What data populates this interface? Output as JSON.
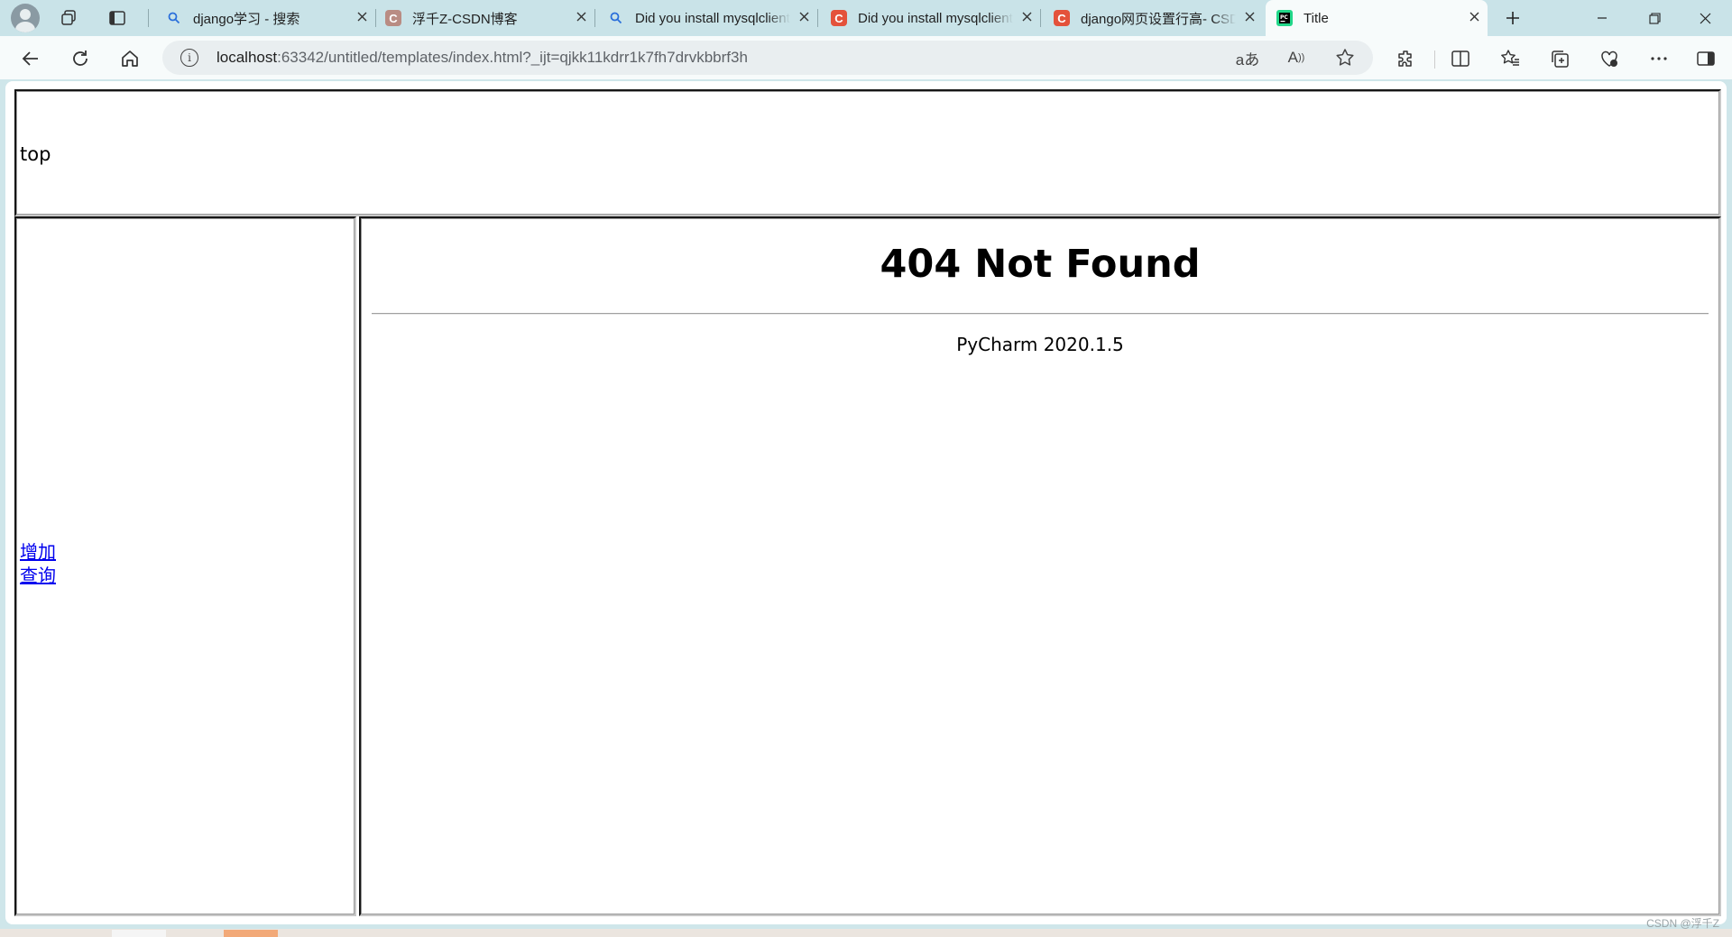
{
  "browser": {
    "tabs": [
      {
        "title": "django学习 - 搜索",
        "favicon": "search-icon",
        "active": false
      },
      {
        "title": "浮千Z-CSDN博客",
        "favicon": "csdn-icon",
        "active": false
      },
      {
        "title": "Did you install mysqlclient",
        "favicon": "search-icon",
        "active": false
      },
      {
        "title": "Did you install mysqlclient",
        "favicon": "csdn-icon",
        "active": false
      },
      {
        "title": "django网页设置行高- CSDN",
        "favicon": "csdn-icon",
        "active": false
      },
      {
        "title": "Title",
        "favicon": "pycharm-icon",
        "active": true
      }
    ],
    "url_host": "localhost",
    "url_rest": ":63342/untitled/templates/index.html?_ijt=qjkk11kdrr1k7fh7drvkbbrf3h",
    "colors": {
      "titlebar": "#c9e3e8",
      "toolbar": "#f7fbfb",
      "csdn": "#e4523b",
      "link": "#0000ee"
    }
  },
  "page": {
    "top_frame": {
      "text": "top"
    },
    "left_frame": {
      "links": [
        {
          "label": "增加"
        },
        {
          "label": "查询"
        }
      ]
    },
    "main_frame": {
      "heading": "404 Not Found",
      "server": "PyCharm 2020.1.5"
    }
  },
  "watermark": "CSDN @浮千Z"
}
